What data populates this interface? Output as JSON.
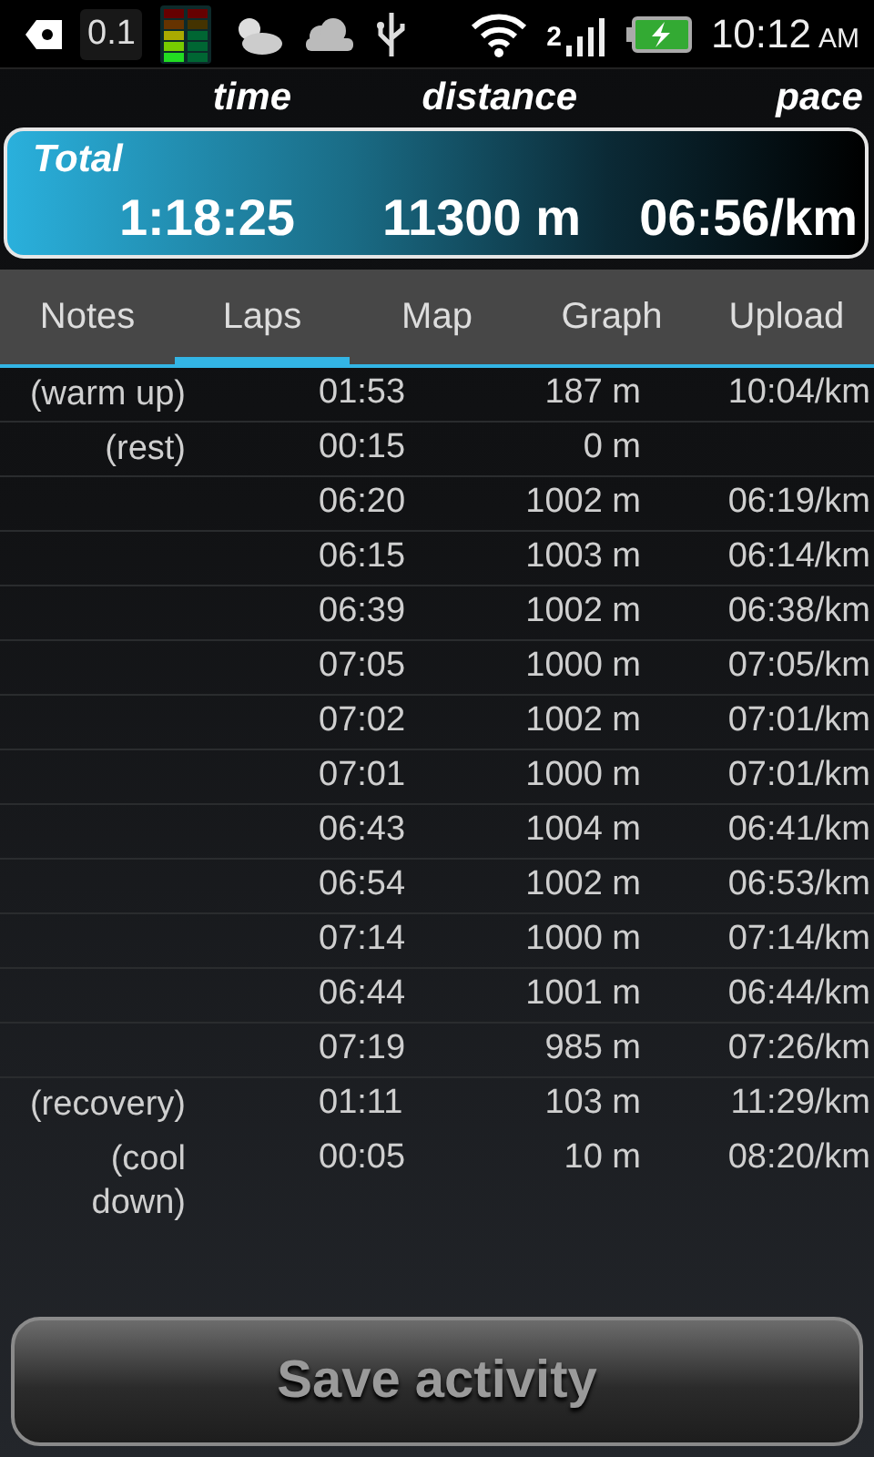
{
  "status_bar": {
    "badge": "0.1",
    "network": "2",
    "clock": "10:12",
    "meridiem": "AM"
  },
  "columns": [
    "time",
    "distance",
    "pace"
  ],
  "total": {
    "label": "Total",
    "time": "1:18:25",
    "distance": "11300 m",
    "pace": "06:56/km"
  },
  "tabs": [
    {
      "label": "Notes",
      "selected": false
    },
    {
      "label": "Laps",
      "selected": true
    },
    {
      "label": "Map",
      "selected": false
    },
    {
      "label": "Graph",
      "selected": false
    },
    {
      "label": "Upload",
      "selected": false
    }
  ],
  "laps": [
    {
      "name": "(warm up)",
      "time": "01:53",
      "distance": "187 m",
      "pace": "10:04/km"
    },
    {
      "name": "(rest)",
      "time": "00:15",
      "distance": "0 m"
    },
    {
      "time": "06:20",
      "distance": "1002 m",
      "pace": "06:19/km"
    },
    {
      "time": "06:15",
      "distance": "1003 m",
      "pace": "06:14/km"
    },
    {
      "time": "06:39",
      "distance": "1002 m",
      "pace": "06:38/km"
    },
    {
      "time": "07:05",
      "distance": "1000 m",
      "pace": "07:05/km"
    },
    {
      "time": "07:02",
      "distance": "1002 m",
      "pace": "07:01/km"
    },
    {
      "time": "07:01",
      "distance": "1000 m",
      "pace": "07:01/km"
    },
    {
      "time": "06:43",
      "distance": "1004 m",
      "pace": "06:41/km"
    },
    {
      "time": "06:54",
      "distance": "1002 m",
      "pace": "06:53/km"
    },
    {
      "time": "07:14",
      "distance": "1000 m",
      "pace": "07:14/km"
    },
    {
      "time": "06:44",
      "distance": "1001 m",
      "pace": "06:44/km"
    },
    {
      "time": "07:19",
      "distance": "985 m",
      "pace": "07:26/km"
    },
    {
      "name": "(recovery)",
      "time": "01:11",
      "distance": "103 m",
      "pace": "11:29/km"
    },
    {
      "name": "(cool down)",
      "time": "00:05",
      "distance": "10 m",
      "pace": "08:20/km"
    }
  ],
  "button": {
    "label": "Save activity",
    "disabled": true
  }
}
